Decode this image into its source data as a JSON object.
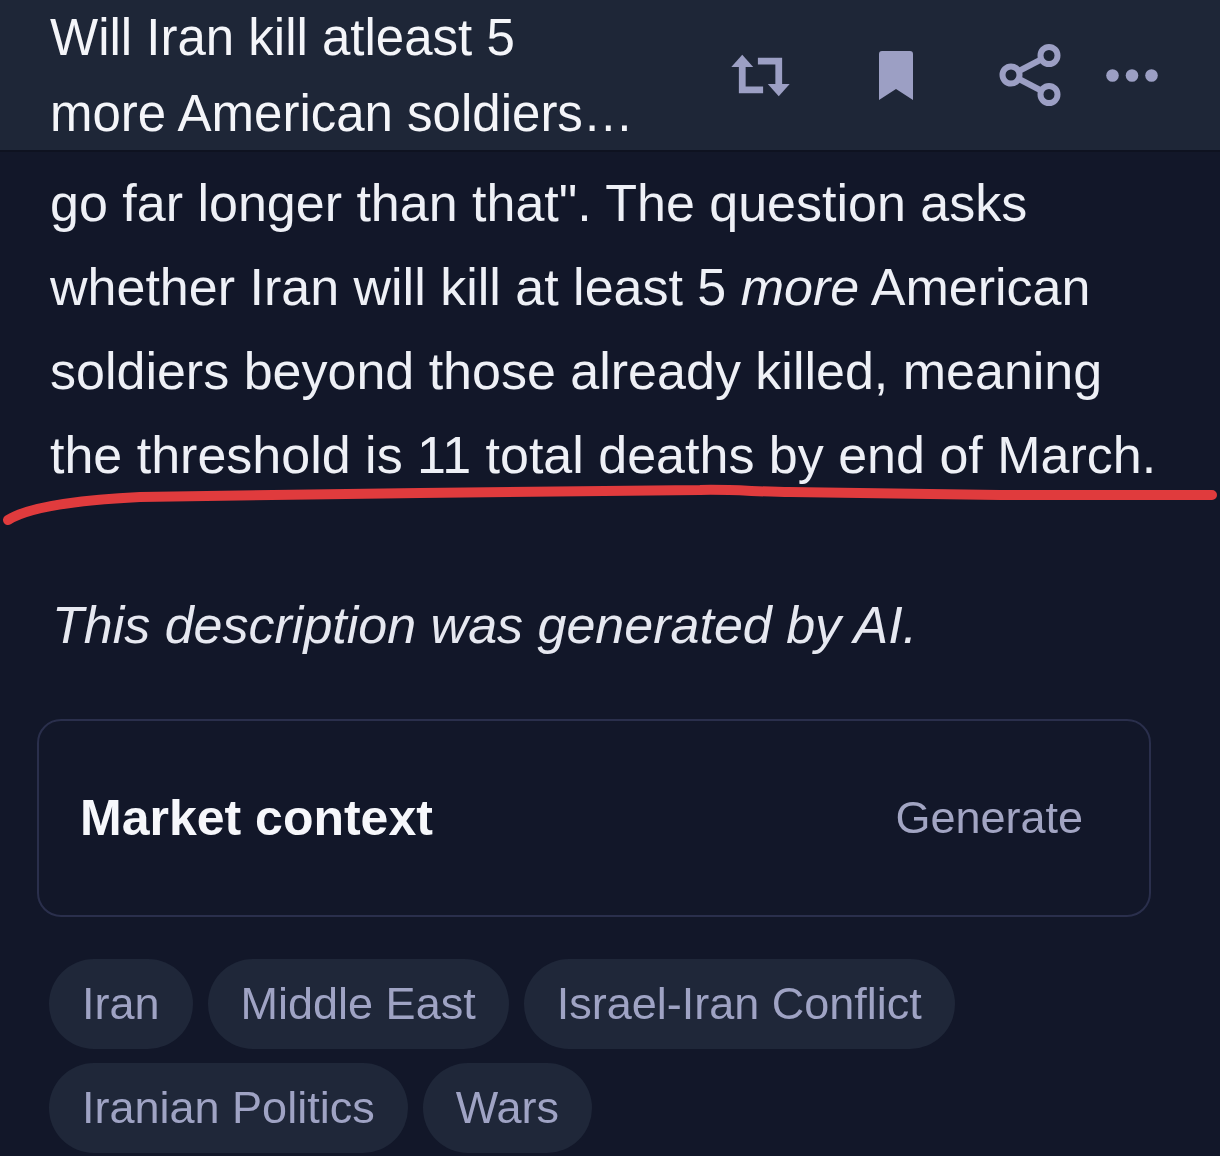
{
  "header": {
    "title": "Will Iran kill atleast 5 more American soldiers…"
  },
  "description": {
    "text": "go far longer than that\". The question asks whether Iran will kill at least 5 *more* American soldiers beyond those already killed, meaning the threshold is 11 total deaths by end of March.",
    "annotation": {
      "kind": "underline"
    },
    "note": "This description was generated by AI."
  },
  "market_context": {
    "title": "Market context",
    "action": "Generate"
  },
  "tags": [
    "Iran",
    "Middle East",
    "Israel-Iran Conflict",
    "Iranian Politics",
    "Wars"
  ]
}
